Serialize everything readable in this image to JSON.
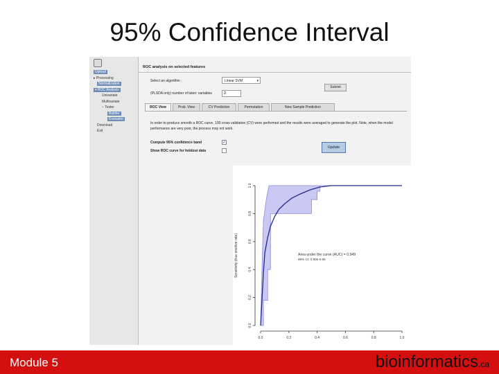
{
  "slide": {
    "title": "95% Confidence Interval",
    "footer_left": "Module 5",
    "footer_right_main": "bioinformatics",
    "footer_right_suffix": ".ca",
    "footer_color": "#d40f0f"
  },
  "sidebar": {
    "items": [
      {
        "label": "Upload",
        "level": 0,
        "active": true
      },
      {
        "label": "▸ Processing",
        "level": 0,
        "active": false
      },
      {
        "label": "Normalization",
        "level": 1,
        "active": true
      },
      {
        "label": "▾ ROC Analysis",
        "level": 0,
        "active": true
      },
      {
        "label": "Univariate",
        "level": 2,
        "active": false
      },
      {
        "label": "Multivariate",
        "level": 2,
        "active": false
      },
      {
        "label": "− Tester",
        "level": 2,
        "active": false
      },
      {
        "label": "Builder",
        "level": 3,
        "active": true
      },
      {
        "label": "Evaluator",
        "level": 3,
        "active": true
      },
      {
        "label": "Download",
        "level": 1,
        "active": false
      },
      {
        "label": "Exit",
        "level": 1,
        "active": false
      }
    ]
  },
  "panel": {
    "header": "ROC analysis on selected features",
    "algorithm_label": "Select an algorithm :",
    "algorithm_value": "Linear SVM",
    "submit_label": "Submit",
    "latent_label": "(PLSDA only) number of laten: variables",
    "latent_value": "2",
    "tabs": [
      "ROC View",
      "Prob. View",
      "CV Prediction",
      "Permutation",
      "New Sample Prediction"
    ],
    "active_tab": "ROC View",
    "description": "In order to produce smooth a ROC curve, 100 cross validation (CV) were performed and the results were averaged to generate the plot. Note, when the model performance are very poor, the process may not work.",
    "opt_compute_label": "Compute 95% confidence band",
    "opt_compute_checked": "✓",
    "opt_holdout_label": "Show ROC curve for holdout data",
    "update_label": "Update"
  },
  "chart_data": {
    "type": "line",
    "ylabel": "Sensitivity (true positive rate)",
    "xlim": [
      0,
      1
    ],
    "ylim": [
      0,
      1
    ],
    "x_ticks": [
      "0.0",
      "0.2",
      "0.4",
      "0.6",
      "0.8",
      "1.0"
    ],
    "y_ticks": [
      "0.0",
      "0.2",
      "0.4",
      "0.6",
      "0.8",
      "1.0"
    ],
    "series": [
      {
        "x": [
          0,
          0.01,
          0.02,
          0.03,
          0.05,
          0.07,
          0.1,
          0.13,
          0.17,
          0.22,
          0.28,
          0.35,
          0.42,
          0.5,
          1.0
        ],
        "y": [
          0,
          0.18,
          0.38,
          0.52,
          0.63,
          0.71,
          0.78,
          0.83,
          0.87,
          0.91,
          0.94,
          0.97,
          0.99,
          1.0,
          1.0
        ]
      }
    ],
    "band_upper": {
      "x": [
        0,
        0.01,
        0.02,
        0.04,
        0.06,
        1.0
      ],
      "y": [
        0,
        0.4,
        0.75,
        0.9,
        1.0,
        1.0
      ]
    },
    "band_lower": {
      "x": [
        0,
        0.02,
        0.02,
        0.05,
        0.05,
        0.07,
        0.07,
        0.18,
        0.18,
        0.36,
        0.36,
        0.4,
        0.4,
        0.42,
        0.42,
        1.0
      ],
      "y": [
        0,
        0,
        0.18,
        0.18,
        0.4,
        0.4,
        0.8,
        0.8,
        0.8,
        0.8,
        0.9,
        0.9,
        0.96,
        0.96,
        1.0,
        1.0
      ]
    },
    "auc_text": "Area under the curve (AUC) = 0.949",
    "ci_text": "95% CI: 0.905-0.99",
    "line_color": "#1f2a8a",
    "band_color": "#c9c9f3"
  }
}
